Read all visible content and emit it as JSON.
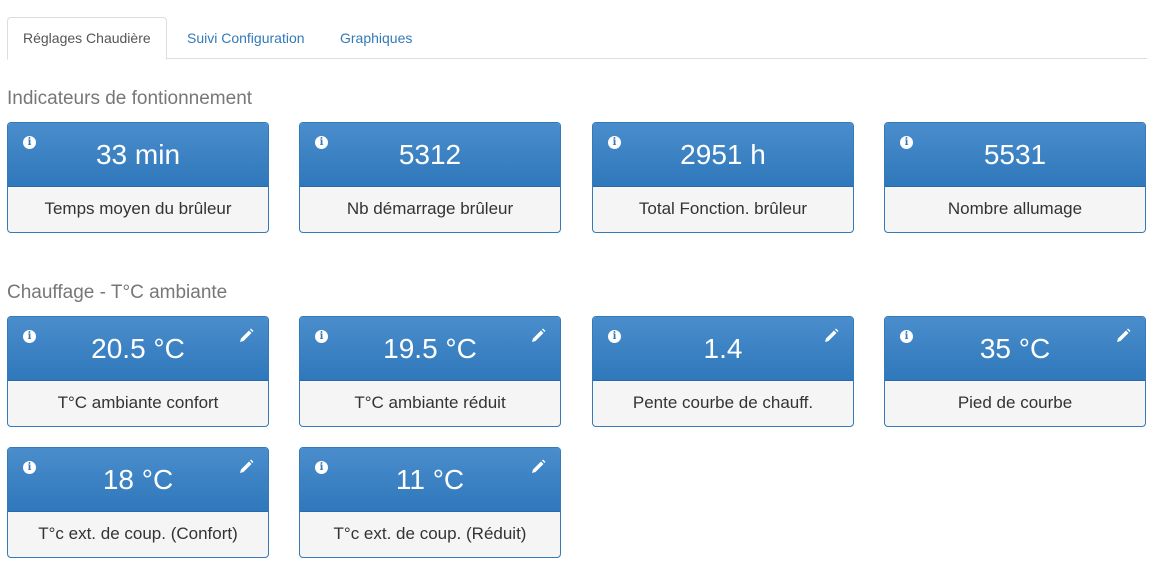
{
  "tabs": [
    {
      "label": "Réglages Chaudière",
      "active": true
    },
    {
      "label": "Suivi Configuration",
      "active": false
    },
    {
      "label": "Graphiques",
      "active": false
    }
  ],
  "sections": [
    {
      "title": "Indicateurs de fontionnement",
      "cards": [
        {
          "value": "33 min",
          "label": "Temps moyen du brûleur",
          "editable": false
        },
        {
          "value": "5312",
          "label": "Nb démarrage brûleur",
          "editable": false
        },
        {
          "value": "2951 h",
          "label": "Total Fonction. brûleur",
          "editable": false
        },
        {
          "value": "5531",
          "label": "Nombre allumage",
          "editable": false
        }
      ]
    },
    {
      "title": "Chauffage - T°C ambiante",
      "cards": [
        {
          "value": "20.5 °C",
          "label": "T°C ambiante confort",
          "editable": true
        },
        {
          "value": "19.5 °C",
          "label": "T°C ambiante réduit",
          "editable": true
        },
        {
          "value": "1.4",
          "label": "Pente courbe de chauff.",
          "editable": true
        },
        {
          "value": "35 °C",
          "label": "Pied de courbe",
          "editable": true
        },
        {
          "value": "18 °C",
          "label": "T°c ext. de coup. (Confort)",
          "editable": true
        },
        {
          "value": "11 °C",
          "label": "T°c ext. de coup. (Réduit)",
          "editable": true
        }
      ]
    }
  ],
  "icons": {
    "info": "info-icon",
    "edit": "pencil-icon"
  },
  "colors": {
    "accent": "#337ab7",
    "card_header": "#3a83c4",
    "card_footer": "#f5f5f5",
    "section_title": "#777777",
    "link": "#337ab7"
  }
}
